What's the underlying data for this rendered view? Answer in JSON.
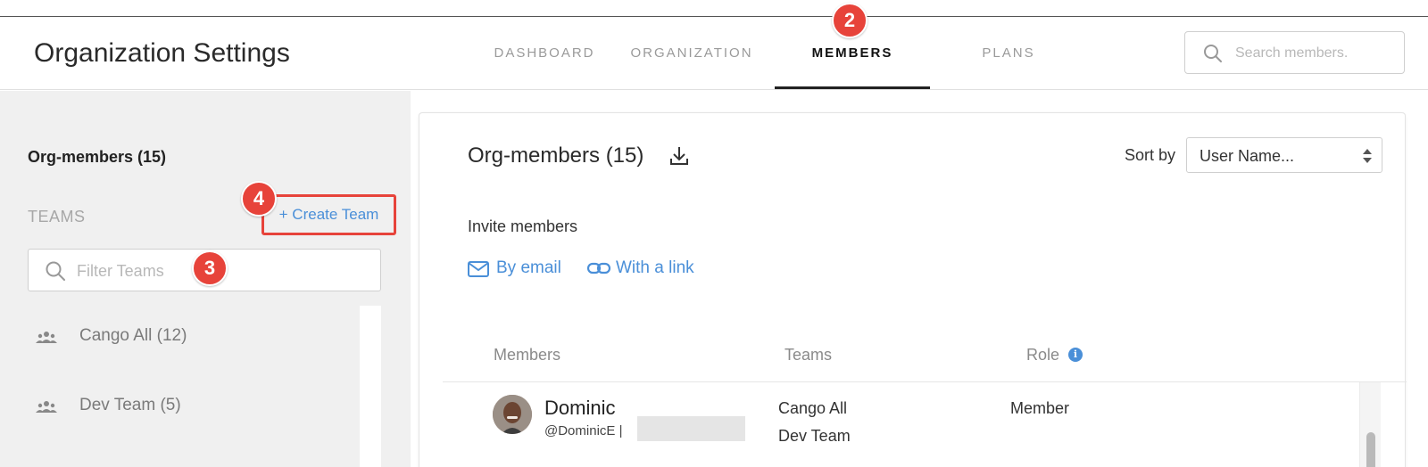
{
  "header": {
    "title": "Organization Settings",
    "tabs": [
      {
        "label": "DASHBOARD",
        "active": false
      },
      {
        "label": "ORGANIZATION",
        "active": false
      },
      {
        "label": "MEMBERS",
        "active": true
      },
      {
        "label": "PLANS",
        "active": false
      }
    ],
    "search": {
      "placeholder": "Search members."
    }
  },
  "sidebar": {
    "org_members": "Org-members (15)",
    "teams_heading": "TEAMS",
    "create_team": "+ Create Team",
    "filter_placeholder": "Filter Teams",
    "teams": [
      {
        "label": "Cango All (12)"
      },
      {
        "label": "Dev Team (5)"
      }
    ]
  },
  "badges": {
    "members_tab": "2",
    "filter": "3",
    "create_team": "4"
  },
  "main": {
    "title": "Org-members (15)",
    "sort_label": "Sort by",
    "sort_value": "User Name...",
    "invite_label": "Invite members",
    "invite_email": "By email",
    "invite_link": "With a link",
    "columns": {
      "members": "Members",
      "teams": "Teams",
      "role": "Role"
    },
    "rows": [
      {
        "name": "Dominic",
        "handle": "@DominicE |",
        "teams": [
          "Cango All",
          "Dev Team"
        ],
        "role": "Member"
      }
    ]
  },
  "colors": {
    "accent": "#4a8fd8",
    "highlight": "#e7433a"
  },
  "icons": [
    "search-icon",
    "download-icon",
    "sort-arrows-icon",
    "mail-icon",
    "link-icon",
    "team-icon",
    "info-icon"
  ]
}
